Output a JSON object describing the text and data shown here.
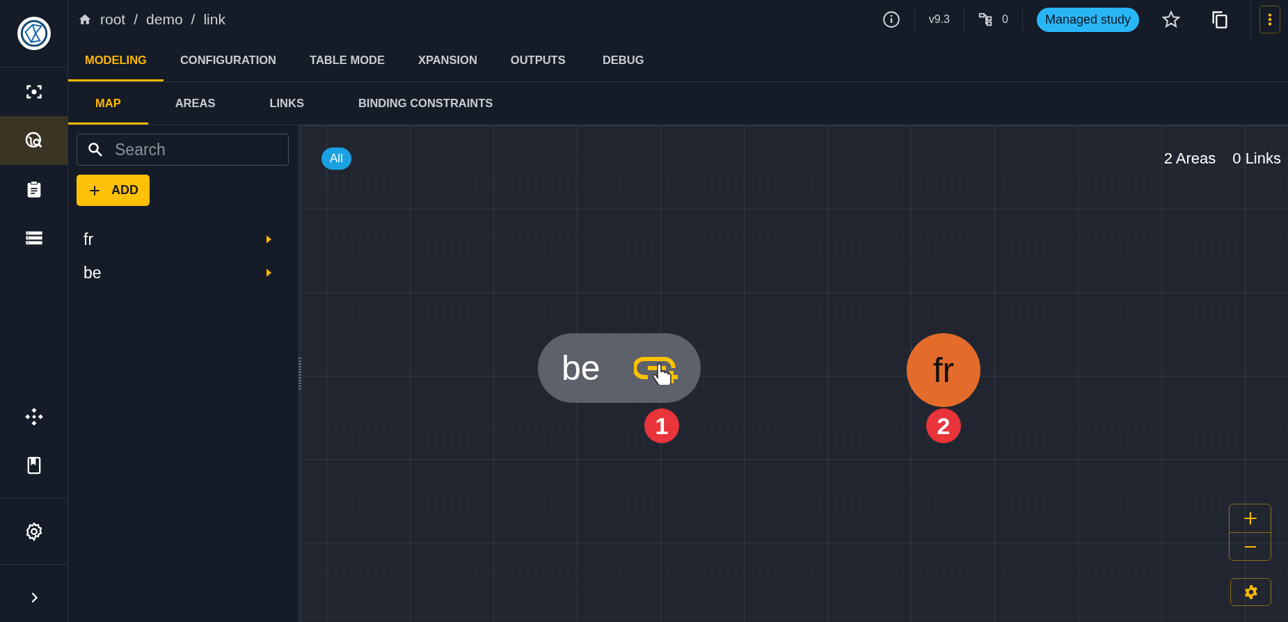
{
  "nav": [
    {
      "kind": "focus",
      "selected": false
    },
    {
      "kind": "explore",
      "selected": true
    },
    {
      "kind": "clipboard",
      "selected": false
    },
    {
      "kind": "storage",
      "selected": false
    },
    {
      "kind": "hub",
      "selected": false
    },
    {
      "kind": "book",
      "selected": false
    },
    {
      "kind": "settings",
      "selected": false
    },
    {
      "kind": "expand",
      "selected": false
    }
  ],
  "breadcrumb": [
    "root",
    "demo",
    "link"
  ],
  "breadcrumb_separators": [
    "/",
    "/"
  ],
  "header": {
    "version": "v9.3",
    "task_count": "0",
    "badge": "Managed study",
    "favorite": false
  },
  "tabs": [
    {
      "label": "MODELING",
      "selected": true
    },
    {
      "label": "CONFIGURATION",
      "selected": false
    },
    {
      "label": "TABLE MODE",
      "selected": false
    },
    {
      "label": "XPANSION",
      "selected": false
    },
    {
      "label": "OUTPUTS",
      "selected": false
    },
    {
      "label": "DEBUG",
      "selected": false
    }
  ],
  "subtabs": [
    {
      "label": "MAP",
      "selected": true
    },
    {
      "label": "AREAS",
      "selected": false
    },
    {
      "label": "LINKS",
      "selected": false
    },
    {
      "label": "BINDING CONSTRAINTS",
      "selected": false
    }
  ],
  "search": {
    "placeholder": "Search"
  },
  "add_button": "ADD",
  "areas": [
    {
      "name": "fr"
    },
    {
      "name": "be"
    }
  ],
  "map": {
    "filter": {
      "label": "All",
      "selected": true
    },
    "areas_count": "2 Areas",
    "links_count": "0 Links",
    "nodes": [
      {
        "name": "be",
        "color": "#5d616a",
        "selected": true,
        "marker": "1"
      },
      {
        "name": "fr",
        "color": "#e46c2b",
        "selected": false,
        "marker": "2"
      }
    ]
  }
}
